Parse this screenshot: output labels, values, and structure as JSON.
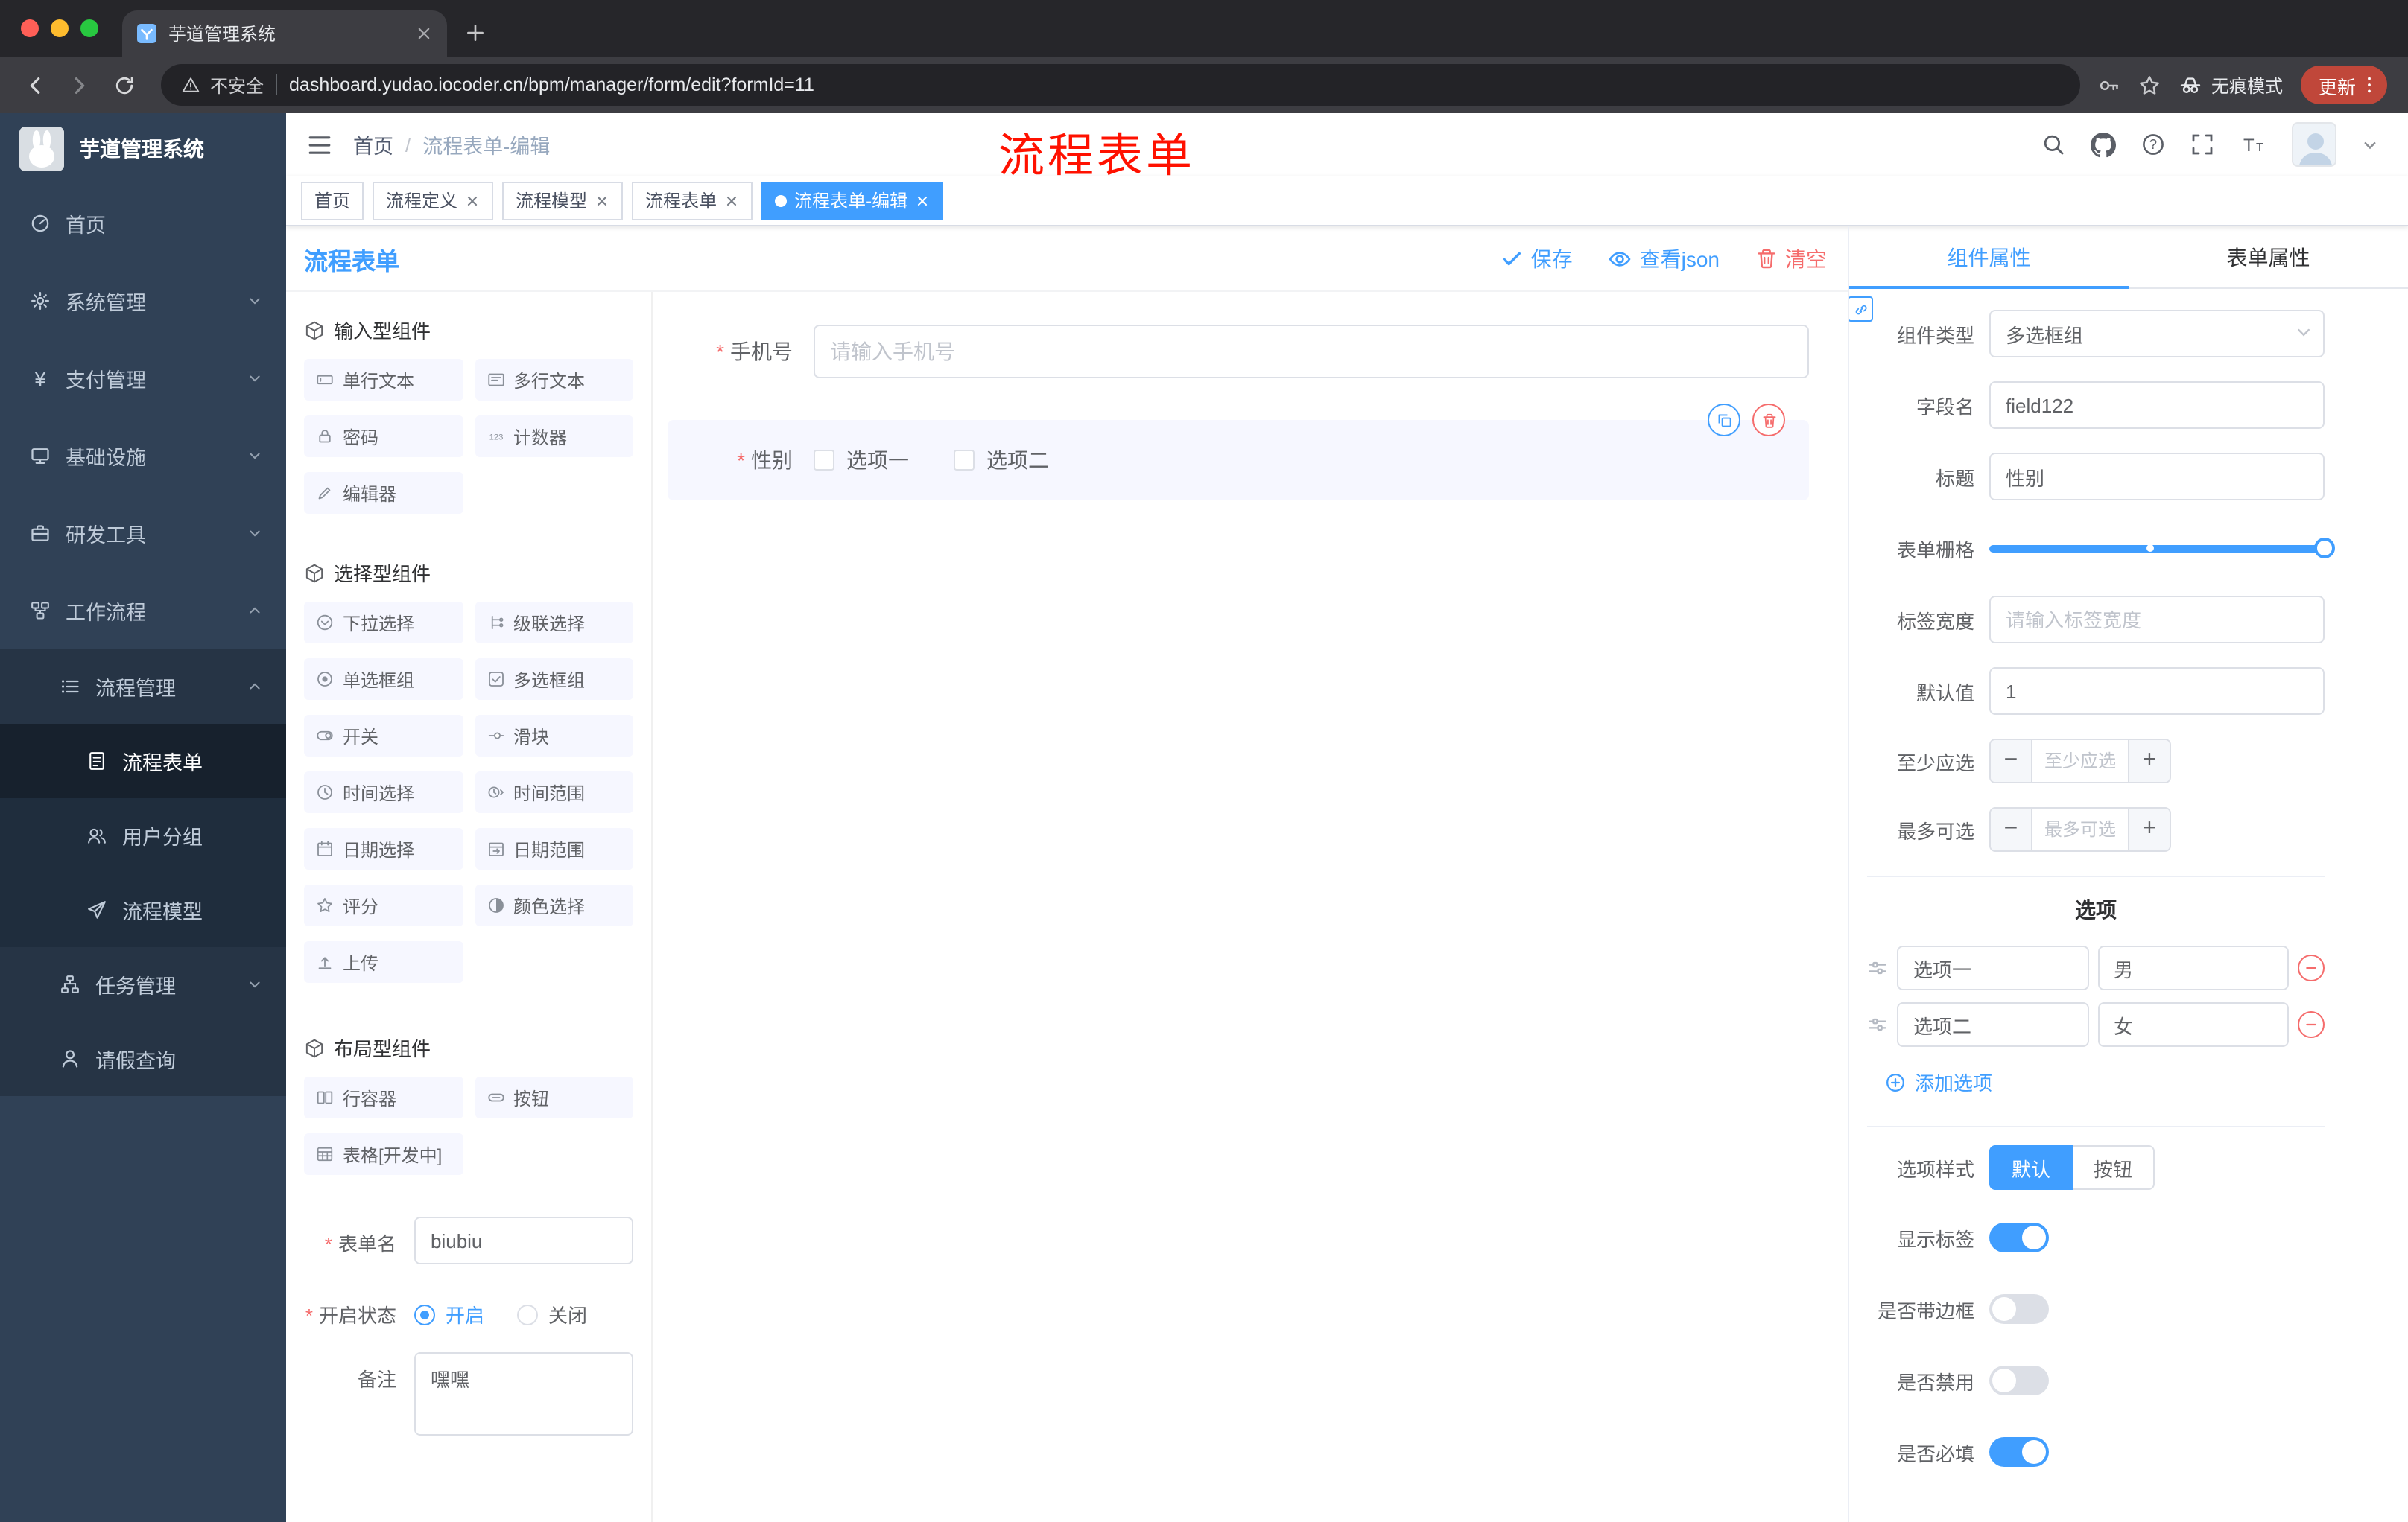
{
  "browser": {
    "tab_title": "芋道管理系统",
    "security_label": "不安全",
    "url": "dashboard.yudao.iocoder.cn/bpm/manager/form/edit?formId=11",
    "incognito_label": "无痕模式",
    "update_label": "更新"
  },
  "sidebar": {
    "logo_title": "芋道管理系统",
    "items": [
      {
        "label": "首页"
      },
      {
        "label": "系统管理"
      },
      {
        "label": "支付管理"
      },
      {
        "label": "基础设施"
      },
      {
        "label": "研发工具"
      },
      {
        "label": "工作流程"
      },
      {
        "label": "流程管理"
      },
      {
        "label": "流程表单"
      },
      {
        "label": "用户分组"
      },
      {
        "label": "流程模型"
      },
      {
        "label": "任务管理"
      },
      {
        "label": "请假查询"
      }
    ]
  },
  "header": {
    "breadcrumb": [
      "首页",
      "流程表单-编辑"
    ],
    "annotation": "流程表单"
  },
  "tags": [
    {
      "label": "首页",
      "closable": false,
      "active": false
    },
    {
      "label": "流程定义",
      "closable": true,
      "active": false
    },
    {
      "label": "流程模型",
      "closable": true,
      "active": false
    },
    {
      "label": "流程表单",
      "closable": true,
      "active": false
    },
    {
      "label": "流程表单-编辑",
      "closable": true,
      "active": true
    }
  ],
  "builder": {
    "title": "流程表单",
    "save_label": "保存",
    "view_json_label": "查看json",
    "clear_label": "清空"
  },
  "components": {
    "input_section": {
      "title": "输入型组件",
      "items": [
        "单行文本",
        "多行文本",
        "密码",
        "计数器",
        "编辑器"
      ]
    },
    "select_section": {
      "title": "选择型组件",
      "items": [
        "下拉选择",
        "级联选择",
        "单选框组",
        "多选框组",
        "开关",
        "滑块",
        "时间选择",
        "时间范围",
        "日期选择",
        "日期范围",
        "评分",
        "颜色选择",
        "上传"
      ]
    },
    "layout_section": {
      "title": "布局型组件",
      "items": [
        "行容器",
        "按钮",
        "表格[开发中]"
      ]
    }
  },
  "meta_form": {
    "name_label": "表单名",
    "name_value": "biubiu",
    "status_label": "开启状态",
    "status_on": "开启",
    "status_off": "关闭",
    "remark_label": "备注",
    "remark_value": "嘿嘿"
  },
  "canvas": {
    "phone_label": "手机号",
    "phone_placeholder": "请输入手机号",
    "gender_label": "性别",
    "gender_options": [
      "选项一",
      "选项二"
    ]
  },
  "properties": {
    "tab_component": "组件属性",
    "tab_form": "表单属性",
    "component_type_label": "组件类型",
    "component_type_value": "多选框组",
    "field_name_label": "字段名",
    "field_name_value": "field122",
    "title_label": "标题",
    "title_value": "性别",
    "grid_label": "表单栅格",
    "label_width_label": "标签宽度",
    "label_width_placeholder": "请输入标签宽度",
    "default_label": "默认值",
    "default_value": "1",
    "min_label": "至少应选",
    "min_placeholder": "至少应选",
    "max_label": "最多可选",
    "max_placeholder": "最多可选",
    "options_title": "选项",
    "options": [
      {
        "value": "选项一",
        "text": "男"
      },
      {
        "value": "选项二",
        "text": "女"
      }
    ],
    "add_option_label": "添加选项",
    "option_style_label": "选项样式",
    "style_options": [
      "默认",
      "按钮"
    ],
    "style_active": "默认",
    "switches": [
      {
        "label": "显示标签",
        "on": true
      },
      {
        "label": "是否带边框",
        "on": false
      },
      {
        "label": "是否禁用",
        "on": false
      },
      {
        "label": "是否必填",
        "on": true
      }
    ]
  },
  "colors": {
    "primary": "#409eff",
    "danger": "#f56c6c",
    "sidebar_bg": "#304156",
    "annotation_red": "#ff1100",
    "traffic_close": "#ff5f57",
    "traffic_minimize": "#febc2e",
    "traffic_zoom": "#28c840"
  },
  "icons": {
    "window": [
      "close-window-button",
      "minimize-window-button",
      "zoom-window-button"
    ],
    "browser": [
      "back-icon",
      "forward-icon",
      "reload-icon",
      "warning-icon",
      "key-icon",
      "star-icon",
      "incognito-icon",
      "kebab-menu-icon",
      "new-tab-icon",
      "close-tab-icon"
    ],
    "app_header": [
      "hamburger-icon",
      "search-icon",
      "github-icon",
      "help-icon",
      "fullscreen-icon",
      "font-size-icon",
      "caret-down-icon"
    ],
    "builder": [
      "check-icon",
      "eye-icon",
      "trash-icon",
      "copy-icon",
      "drag-icon",
      "circle-plus-icon",
      "circle-minus-icon",
      "link-icon"
    ]
  }
}
